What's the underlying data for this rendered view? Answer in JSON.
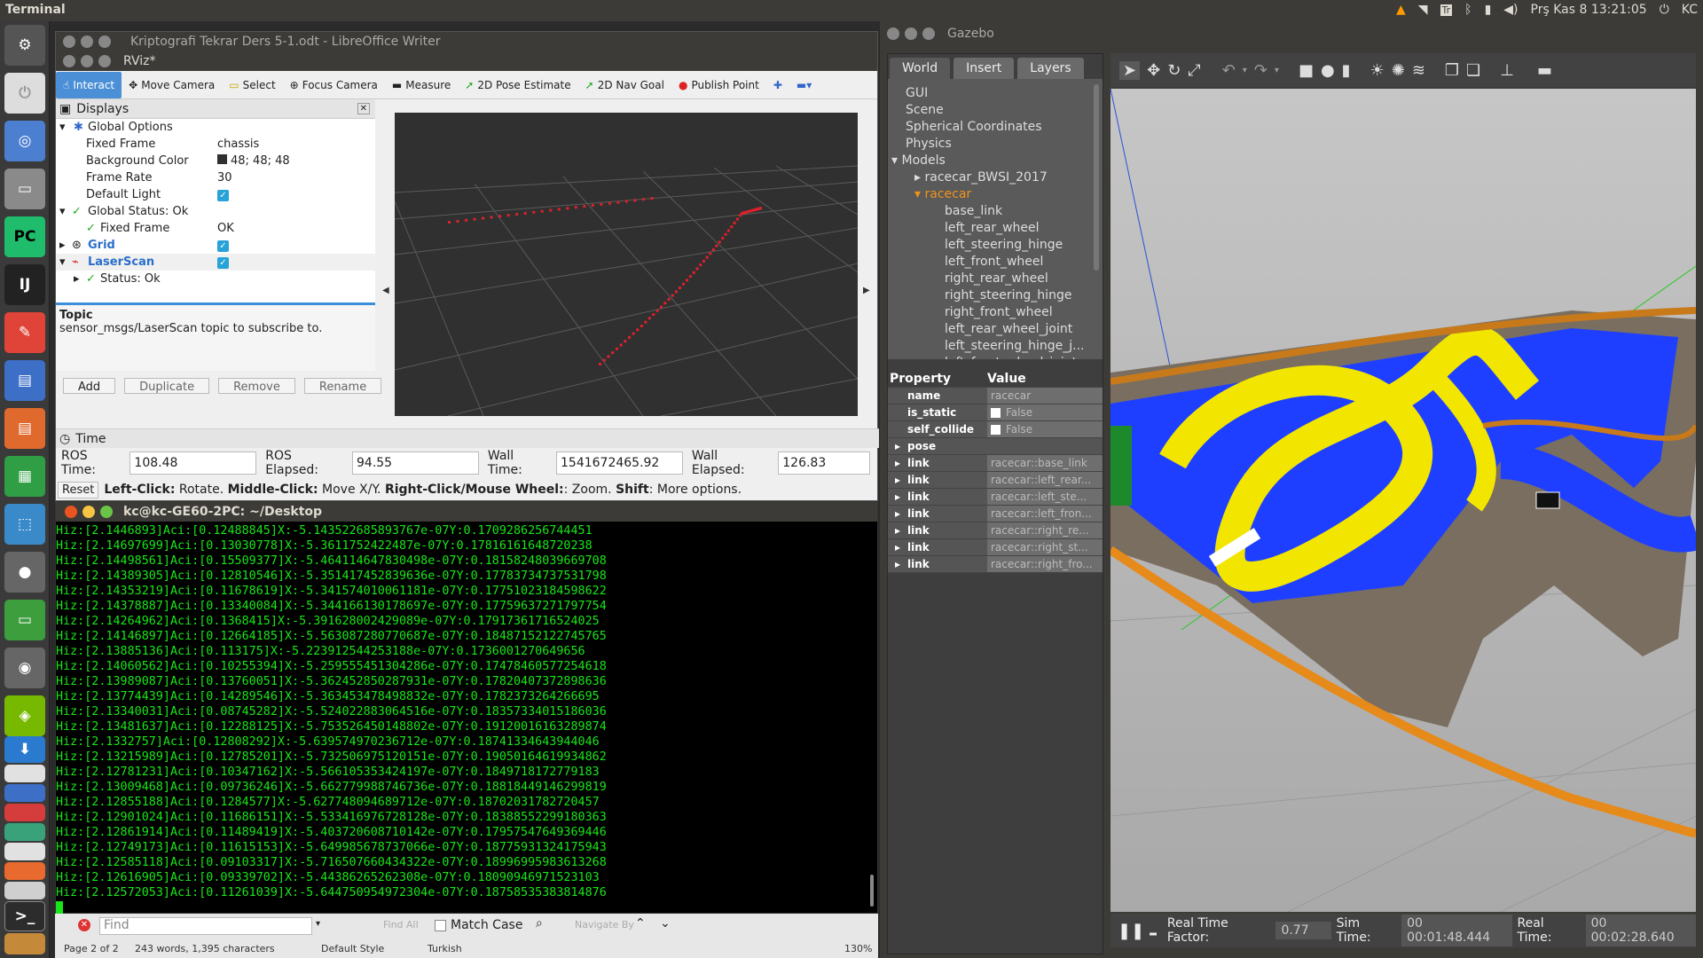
{
  "topbar": {
    "app_title": "Terminal",
    "datetime": "Prş Kas 8 13:21:05",
    "user": "KC"
  },
  "launcher": {
    "items": [
      "ubuntu-logo",
      "blank",
      "chromium",
      "files",
      "pycharm",
      "intellij",
      "pdf",
      "writer",
      "impress",
      "calc",
      "store",
      "settings",
      "monitor",
      "disk",
      "nvidia",
      "download",
      "box1",
      "box2",
      "box3",
      "box4",
      "box5",
      "box6",
      "box7",
      "box8",
      "terminal",
      "box9"
    ]
  },
  "rviz": {
    "behind_title": "Kriptografi Tekrar Ders 5-1.odt - LibreOffice Writer",
    "title": "RViz*",
    "tools": [
      "Interact",
      "Move Camera",
      "Select",
      "Focus Camera",
      "Measure",
      "2D Pose Estimate",
      "2D Nav Goal",
      "Publish Point"
    ],
    "displays_title": "Displays",
    "tree": {
      "global_options": "Global Options",
      "fixed_frame_label": "Fixed Frame",
      "fixed_frame_value": "chassis",
      "bg_label": "Background Color",
      "bg_value": "48; 48; 48",
      "rate_label": "Frame Rate",
      "rate_value": "30",
      "light_label": "Default Light",
      "status_label": "Global Status: Ok",
      "status_ff_label": "Fixed Frame",
      "status_ff_value": "OK",
      "grid_label": "Grid",
      "laser_label": "LaserScan",
      "laser_status": "Status: Ok"
    },
    "topic_title": "Topic",
    "topic_desc": "sensor_msgs/LaserScan topic to subscribe to.",
    "buttons": {
      "add": "Add",
      "duplicate": "Duplicate",
      "remove": "Remove",
      "rename": "Rename"
    },
    "time_title": "Time",
    "ros_time_label": "ROS Time:",
    "ros_time": "108.48",
    "ros_elapsed_label": "ROS Elapsed:",
    "ros_elapsed": "94.55",
    "wall_time_label": "Wall Time:",
    "wall_time": "1541672465.92",
    "wall_elapsed_label": "Wall Elapsed:",
    "wall_elapsed": "126.83",
    "reset": "Reset",
    "hint_a": "Left-Click:",
    "hint_b": " Rotate. ",
    "hint_c": "Middle-Click:",
    "hint_d": " Move X/Y. ",
    "hint_e": "Right-Click/Mouse Wheel:",
    "hint_f": ": Zoom. ",
    "hint_g": "Shift",
    "hint_h": ": More options."
  },
  "terminal": {
    "title": "kc@kc-GE60-2PC: ~/Desktop",
    "lines": [
      "Hiz:[2.1446893]Aci:[0.12488845]X:-5.143522685893767e-07Y:0.1709286256744451",
      "Hiz:[2.14697699]Aci:[0.13030778]X:-5.3611752422487e-07Y:0.17816161648720238",
      "Hiz:[2.14498561]Aci:[0.15509377]X:-5.464114647830498e-07Y:0.18158248039669708",
      "Hiz:[2.14389305]Aci:[0.12810546]X:-5.351417452839636e-07Y:0.17783734737531798",
      "Hiz:[2.14353219]Aci:[0.11678619]X:-5.341574010061181e-07Y:0.17751023184598622",
      "Hiz:[2.14378887]Aci:[0.13340084]X:-5.344166130178697e-07Y:0.17759637271797754",
      "Hiz:[2.14264962]Aci:[0.1368415]X:-5.391628002429089e-07Y:0.17917361716524025",
      "Hiz:[2.14146897]Aci:[0.12664185]X:-5.563087280770687e-07Y:0.18487152122745765",
      "Hiz:[2.13885136]Aci:[0.113175]X:-5.223912544253188e-07Y:0.1736001270649656",
      "Hiz:[2.14060562]Aci:[0.10255394]X:-5.259555451304286e-07Y:0.17478460577254618",
      "Hiz:[2.13989087]Aci:[0.13760051]X:-5.362452850287931e-07Y:0.17820407372898636",
      "Hiz:[2.13774439]Aci:[0.14289546]X:-5.363453478498832e-07Y:0.1782373264266695",
      "Hiz:[2.13340031]Aci:[0.08745282]X:-5.524022883064516e-07Y:0.18357334015186036",
      "Hiz:[2.13481637]Aci:[0.12288125]X:-5.753526450148802e-07Y:0.19120016163289874",
      "Hiz:[2.1332757]Aci:[0.12808292]X:-5.639574970236712e-07Y:0.18741334643944046",
      "Hiz:[2.13215989]Aci:[0.12785201]X:-5.732506975120151e-07Y:0.19050164619934862",
      "Hiz:[2.12781231]Aci:[0.10347162]X:-5.566105353424197e-07Y:0.1849718172779183",
      "Hiz:[2.13009468]Aci:[0.09736246]X:-5.662779988746736e-07Y:0.18818449146299819",
      "Hiz:[2.12855188]Aci:[0.1284577]X:-5.627748094689712e-07Y:0.18702031782720457",
      "Hiz:[2.12901024]Aci:[0.11686151]X:-5.533416976728128e-07Y:0.18388552299180363",
      "Hiz:[2.12861914]Aci:[0.11489419]X:-5.403720608710142e-07Y:0.17957547649369446",
      "Hiz:[2.12749173]Aci:[0.11615153]X:-5.649985678737066e-07Y:0.18775931324175943",
      "Hiz:[2.12585118]Aci:[0.09103317]X:-5.716507660434322e-07Y:0.18996995983613268",
      "Hiz:[2.12616905]Aci:[0.09339702]X:-5.44386265262308e-07Y:0.18090946971523103",
      "Hiz:[2.12572053]Aci:[0.11261039]X:-5.644750954972304e-07Y:0.18758535383814876"
    ]
  },
  "writer_findbar": {
    "find_placeholder": "Find",
    "find_all": "Find All",
    "match_case": "Match Case",
    "navigate": "Navigate By",
    "status_page": "Page 2 of 2",
    "status_words": "243 words, 1,395 characters",
    "status_style": "Default Style",
    "status_lang": "Turkish",
    "status_zoom": "130%"
  },
  "gazebo": {
    "title": "Gazebo",
    "tabs": [
      "World",
      "Insert",
      "Layers"
    ],
    "tree": {
      "gui": "GUI",
      "scene": "Scene",
      "spherical": "Spherical Coordinates",
      "physics": "Physics",
      "models": "Models",
      "model1": "racecar_BWSI_2017",
      "model2": "racecar",
      "links": [
        "base_link",
        "left_rear_wheel",
        "left_steering_hinge",
        "left_front_wheel",
        "right_rear_wheel",
        "right_steering_hinge",
        "right_front_wheel",
        "left_rear_wheel_joint",
        "left_steering_hinge_j...",
        "left_front_wheel_joint"
      ]
    },
    "props_header": {
      "property": "Property",
      "value": "Value"
    },
    "props": [
      {
        "k": "name",
        "v": "racecar"
      },
      {
        "k": "is_static",
        "v": "False"
      },
      {
        "k": "self_collide",
        "v": "False"
      },
      {
        "k": "pose",
        "v": ""
      },
      {
        "k": "link",
        "v": "racecar::base_link"
      },
      {
        "k": "link",
        "v": "racecar::left_rear..."
      },
      {
        "k": "link",
        "v": "racecar::left_ste..."
      },
      {
        "k": "link",
        "v": "racecar::left_fron..."
      },
      {
        "k": "link",
        "v": "racecar::right_re..."
      },
      {
        "k": "link",
        "v": "racecar::right_st..."
      },
      {
        "k": "link",
        "v": "racecar::right_fro..."
      }
    ],
    "status": {
      "rtf_label": "Real Time Factor:",
      "rtf": "0.77",
      "sim_label": "Sim Time:",
      "sim": "00 00:01:48.444",
      "real_label": "Real Time:",
      "real": "00 00:02:28.640"
    }
  }
}
